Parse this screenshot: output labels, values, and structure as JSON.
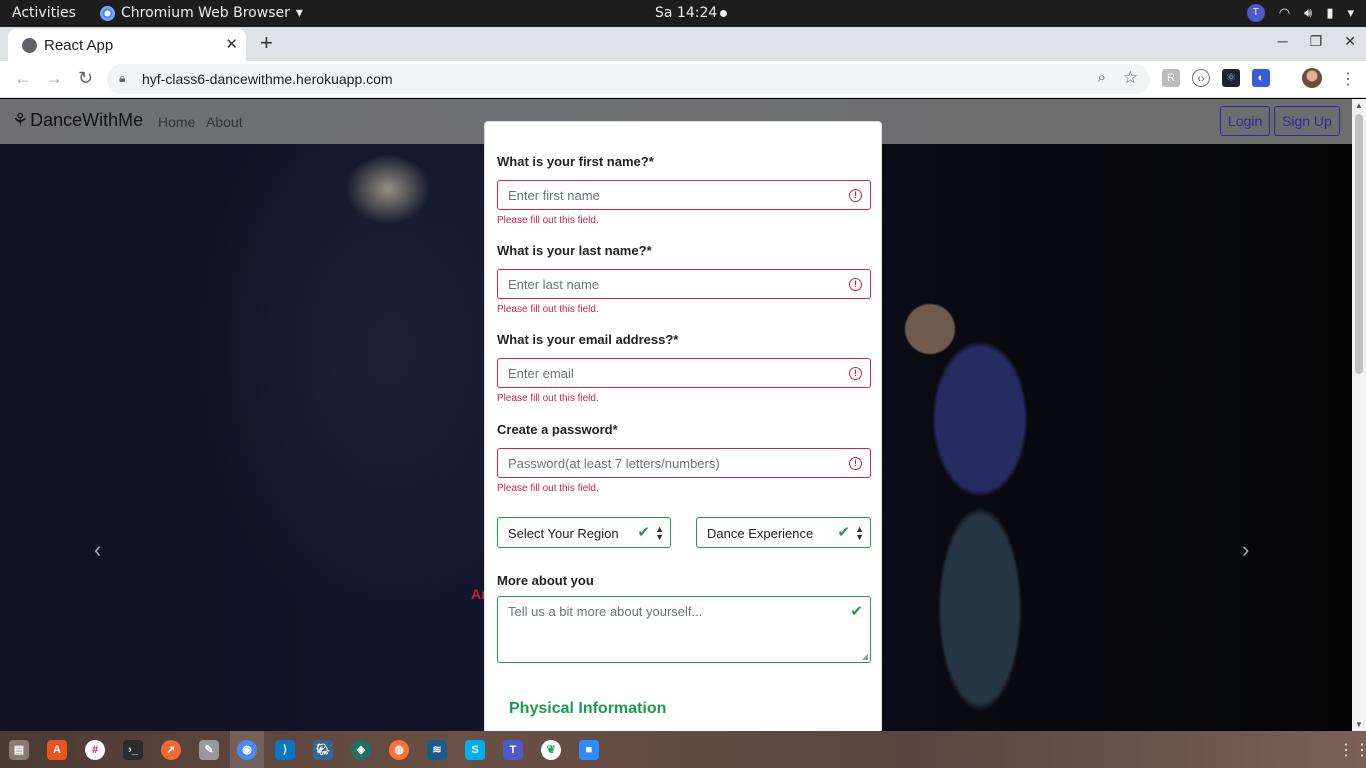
{
  "topbar": {
    "activities": "Activities",
    "app_name": "Chromium Web Browser",
    "clock": "Sa 14:24"
  },
  "browser": {
    "tab_title": "React App",
    "url": "hyf-class6-dancewithme.herokuapp.com"
  },
  "site": {
    "brand": "DanceWithMe",
    "nav": {
      "home": "Home",
      "about": "About"
    },
    "login": "Login",
    "signup": "Sign Up",
    "background_fragment": "Ar"
  },
  "form": {
    "first_name": {
      "label": "What is your first name?*",
      "placeholder": "Enter first name",
      "error": "Please fill out this field."
    },
    "last_name": {
      "label": "What is your last name?*",
      "placeholder": "Enter last name",
      "error": "Please fill out this field."
    },
    "email": {
      "label": "What is your email address?*",
      "placeholder": "Enter email",
      "error": "Please fill out this field."
    },
    "password": {
      "label": "Create a password*",
      "placeholder": "Password(at least 7 letters/numbers)",
      "error": "Please fill out this field."
    },
    "region": {
      "value": "Select Your Region"
    },
    "experience": {
      "value": "Dance Experience"
    },
    "about": {
      "label": "More about you",
      "placeholder": "Tell us a bit more about yourself..."
    },
    "physical_title": "Physical Information"
  },
  "colors": {
    "error": "#d0234f",
    "valid": "#1a9e4a",
    "auth_button": "#2d2a9a"
  }
}
